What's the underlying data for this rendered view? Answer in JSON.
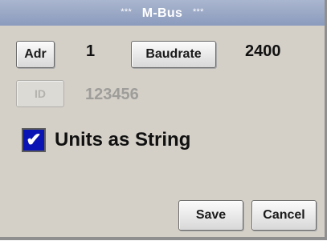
{
  "window": {
    "title_prefix": "***",
    "title": "M-Bus",
    "title_suffix": "***"
  },
  "address": {
    "button_label": "Adr",
    "value": "1"
  },
  "baudrate": {
    "button_label": "Baudrate",
    "value": "2400"
  },
  "id": {
    "button_label": "ID",
    "value": "123456",
    "enabled": false
  },
  "units_as_string": {
    "label": "Units as String",
    "checked": true,
    "check_glyph": "✔",
    "box_color": "#0a14b4"
  },
  "actions": {
    "save_label": "Save",
    "cancel_label": "Cancel"
  },
  "colors": {
    "panel_background": "#d4d0c8",
    "title_bar": "#8b9bbd",
    "disabled_text": "#9e9d99"
  }
}
